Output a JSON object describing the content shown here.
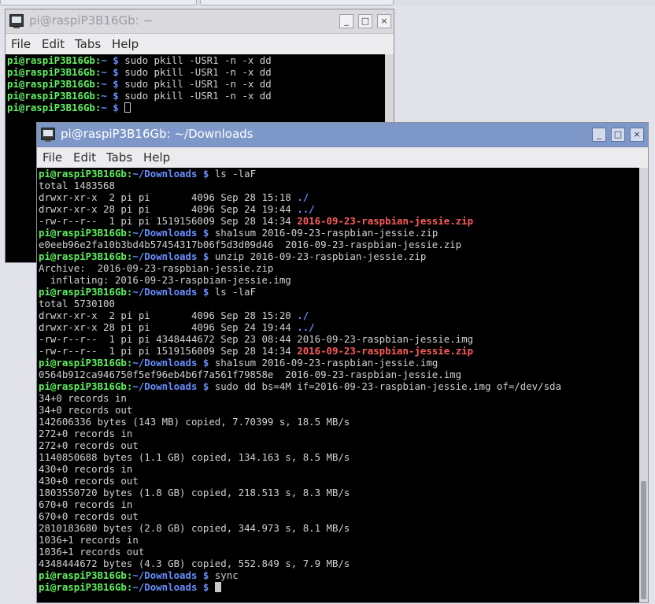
{
  "back_window": {
    "title": "pi@raspiP3B16Gb: ~",
    "menu": [
      "File",
      "Edit",
      "Tabs",
      "Help"
    ],
    "controls": {
      "minimize": "_",
      "maximize": "□",
      "close": "×"
    },
    "prompt": {
      "user": "pi@raspiP3B16Gb",
      "sep": ":",
      "path": "~",
      "sym": " $ "
    },
    "commands": [
      "sudo pkill -USR1 -n -x dd",
      "sudo pkill -USR1 -n -x dd",
      "sudo pkill -USR1 -n -x dd",
      "sudo pkill -USR1 -n -x dd"
    ]
  },
  "front_window": {
    "title": "pi@raspiP3B16Gb: ~/Downloads",
    "menu": [
      "File",
      "Edit",
      "Tabs",
      "Help"
    ],
    "controls": {
      "minimize": "_",
      "maximize": "□",
      "close": "×"
    },
    "prompt": {
      "user": "pi@raspiP3B16Gb",
      "sep": ":",
      "path": "~/Downloads",
      "sym": " $ "
    },
    "lines": [
      {
        "type": "cmd",
        "text": "ls -laF"
      },
      {
        "type": "out",
        "text": "total 1483568"
      },
      {
        "type": "ls",
        "text": "drwxr-xr-x  2 pi pi       4096 Sep 28 15:18 ",
        "name": "./",
        "style": "dir"
      },
      {
        "type": "ls",
        "text": "drwxr-xr-x 28 pi pi       4096 Sep 24 19:44 ",
        "name": "../",
        "style": "dir"
      },
      {
        "type": "ls",
        "text": "-rw-r--r--  1 pi pi 1519156009 Sep 28 14:34 ",
        "name": "2016-09-23-raspbian-jessie.zip",
        "style": "zip"
      },
      {
        "type": "cmd",
        "text": "sha1sum 2016-09-23-raspbian-jessie.zip"
      },
      {
        "type": "out",
        "text": "e0eeb96e2fa10b3bd4b57454317b06f5d3d09d46  2016-09-23-raspbian-jessie.zip"
      },
      {
        "type": "cmd",
        "text": "unzip 2016-09-23-raspbian-jessie.zip"
      },
      {
        "type": "out",
        "text": "Archive:  2016-09-23-raspbian-jessie.zip"
      },
      {
        "type": "out",
        "text": "  inflating: 2016-09-23-raspbian-jessie.img"
      },
      {
        "type": "cmd",
        "text": "ls -laF"
      },
      {
        "type": "out",
        "text": "total 5730100"
      },
      {
        "type": "ls",
        "text": "drwxr-xr-x  2 pi pi       4096 Sep 28 15:20 ",
        "name": "./",
        "style": "dir"
      },
      {
        "type": "ls",
        "text": "drwxr-xr-x 28 pi pi       4096 Sep 24 19:44 ",
        "name": "../",
        "style": "dir"
      },
      {
        "type": "ls",
        "text": "-rw-r--r--  1 pi pi 4348444672 Sep 23 08:44 ",
        "name": "2016-09-23-raspbian-jessie.img",
        "style": "plain"
      },
      {
        "type": "ls",
        "text": "-rw-r--r--  1 pi pi 1519156009 Sep 28 14:34 ",
        "name": "2016-09-23-raspbian-jessie.zip",
        "style": "zip"
      },
      {
        "type": "cmd",
        "text": "sha1sum 2016-09-23-raspbian-jessie.img"
      },
      {
        "type": "out",
        "text": "0564b912ca946750f5ef96eb4b6f7a561f79858e  2016-09-23-raspbian-jessie.img"
      },
      {
        "type": "cmd",
        "text": "sudo dd bs=4M if=2016-09-23-raspbian-jessie.img of=/dev/sda"
      },
      {
        "type": "out",
        "text": "34+0 records in"
      },
      {
        "type": "out",
        "text": "34+0 records out"
      },
      {
        "type": "out",
        "text": "142606336 bytes (143 MB) copied, 7.70399 s, 18.5 MB/s"
      },
      {
        "type": "out",
        "text": "272+0 records in"
      },
      {
        "type": "out",
        "text": "272+0 records out"
      },
      {
        "type": "out",
        "text": "1140850688 bytes (1.1 GB) copied, 134.163 s, 8.5 MB/s"
      },
      {
        "type": "out",
        "text": "430+0 records in"
      },
      {
        "type": "out",
        "text": "430+0 records out"
      },
      {
        "type": "out",
        "text": "1803550720 bytes (1.8 GB) copied, 218.513 s, 8.3 MB/s"
      },
      {
        "type": "out",
        "text": "670+0 records in"
      },
      {
        "type": "out",
        "text": "670+0 records out"
      },
      {
        "type": "out",
        "text": "2810183680 bytes (2.8 GB) copied, 344.973 s, 8.1 MB/s"
      },
      {
        "type": "out",
        "text": "1036+1 records in"
      },
      {
        "type": "out",
        "text": "1036+1 records out"
      },
      {
        "type": "out",
        "text": "4348444672 bytes (4.3 GB) copied, 552.849 s, 7.9 MB/s"
      },
      {
        "type": "cmd",
        "text": "sync"
      }
    ]
  },
  "colors": {
    "terminal_bg": "#000000",
    "prompt_user": "#5ff05f",
    "prompt_path": "#6a8fff",
    "zip_file": "#ff5a5a",
    "active_titlebar": "#7d97c9"
  }
}
